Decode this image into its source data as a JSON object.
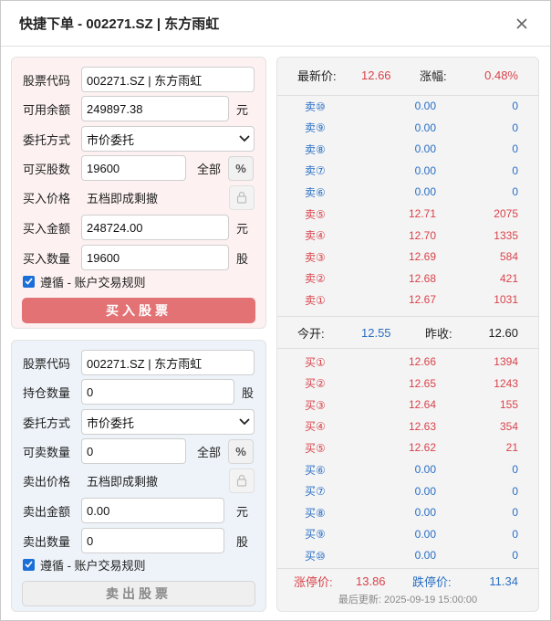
{
  "window": {
    "title": "快捷下单 - 002271.SZ | 东方雨虹",
    "close_icon": "close-icon"
  },
  "buy": {
    "stock_code_label": "股票代码",
    "stock_code_value": "002271.SZ | 东方雨虹",
    "balance_label": "可用余额",
    "balance_value": "249897.38",
    "balance_unit": "元",
    "order_type_label": "委托方式",
    "order_type_value": "市价委托",
    "max_shares_label": "可买股数",
    "max_shares_value": "19600",
    "all_label": "全部",
    "price_label": "买入价格",
    "price_value": "五档即成剩撤",
    "amount_label": "买入金额",
    "amount_value": "248724.00",
    "amount_unit": "元",
    "qty_label": "买入数量",
    "qty_value": "19600",
    "qty_unit": "股",
    "rule_label": "遵循 - 账户交易规则",
    "submit_label": "买入股票"
  },
  "sell": {
    "stock_code_label": "股票代码",
    "stock_code_value": "002271.SZ | 东方雨虹",
    "position_label": "持仓数量",
    "position_value": "0",
    "position_unit": "股",
    "order_type_label": "委托方式",
    "order_type_value": "市价委托",
    "max_shares_label": "可卖数量",
    "max_shares_value": "0",
    "all_label": "全部",
    "price_label": "卖出价格",
    "price_value": "五档即成剩撤",
    "amount_label": "卖出金额",
    "amount_value": "0.00",
    "amount_unit": "元",
    "qty_label": "卖出数量",
    "qty_value": "0",
    "qty_unit": "股",
    "rule_label": "遵循 - 账户交易规则",
    "submit_label": "卖出股票"
  },
  "quote": {
    "last_label": "最新价:",
    "last_value": "12.66",
    "change_label": "涨幅:",
    "change_value": "0.48%",
    "asks": [
      {
        "name": "卖⑩",
        "price": "0.00",
        "vol": "0"
      },
      {
        "name": "卖⑨",
        "price": "0.00",
        "vol": "0"
      },
      {
        "name": "卖⑧",
        "price": "0.00",
        "vol": "0"
      },
      {
        "name": "卖⑦",
        "price": "0.00",
        "vol": "0"
      },
      {
        "name": "卖⑥",
        "price": "0.00",
        "vol": "0"
      },
      {
        "name": "卖⑤",
        "price": "12.71",
        "vol": "2075"
      },
      {
        "name": "卖④",
        "price": "12.70",
        "vol": "1335"
      },
      {
        "name": "卖③",
        "price": "12.69",
        "vol": "584"
      },
      {
        "name": "卖②",
        "price": "12.68",
        "vol": "421"
      },
      {
        "name": "卖①",
        "price": "12.67",
        "vol": "1031"
      }
    ],
    "open_label": "今开:",
    "open_value": "12.55",
    "prev_close_label": "昨收:",
    "prev_close_value": "12.60",
    "bids": [
      {
        "name": "买①",
        "price": "12.66",
        "vol": "1394"
      },
      {
        "name": "买②",
        "price": "12.65",
        "vol": "1243"
      },
      {
        "name": "买③",
        "price": "12.64",
        "vol": "155"
      },
      {
        "name": "买④",
        "price": "12.63",
        "vol": "354"
      },
      {
        "name": "买⑤",
        "price": "12.62",
        "vol": "21"
      },
      {
        "name": "买⑥",
        "price": "0.00",
        "vol": "0"
      },
      {
        "name": "买⑦",
        "price": "0.00",
        "vol": "0"
      },
      {
        "name": "买⑧",
        "price": "0.00",
        "vol": "0"
      },
      {
        "name": "买⑨",
        "price": "0.00",
        "vol": "0"
      },
      {
        "name": "买⑩",
        "price": "0.00",
        "vol": "0"
      }
    ],
    "limit_up_label": "涨停价:",
    "limit_up_value": "13.86",
    "limit_down_label": "跌停价:",
    "limit_down_value": "11.34",
    "updated": "最后更新: 2025-09-19 15:00:00"
  },
  "colors": {
    "up": "#d9434b",
    "down": "#2a6fc4",
    "buy_button": "#e37275",
    "checkbox": "#1a6fd8"
  }
}
